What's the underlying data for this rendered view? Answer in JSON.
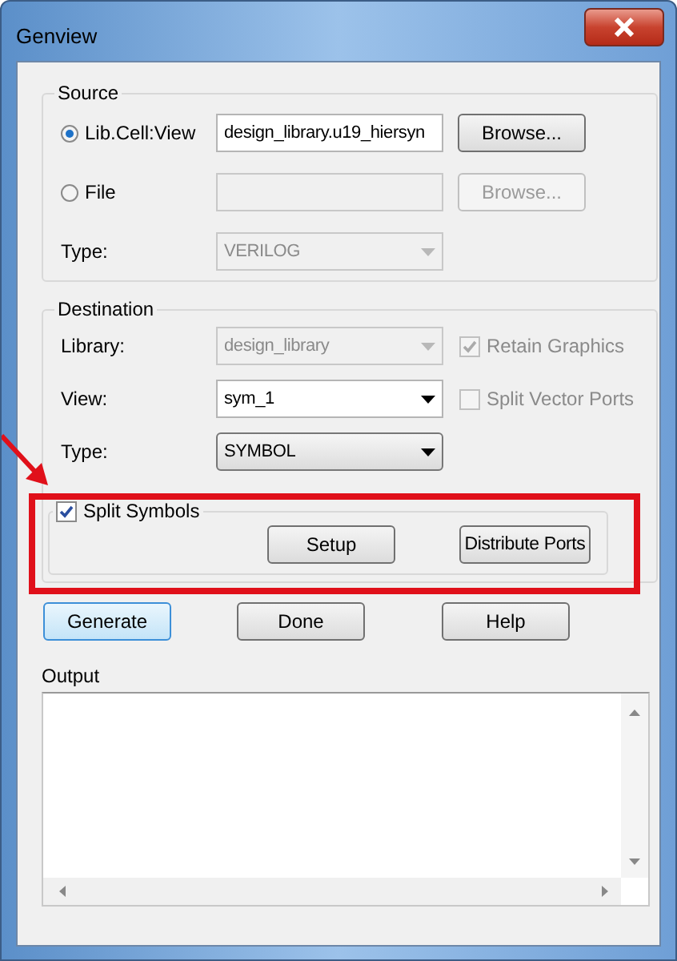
{
  "window": {
    "title": "Genview"
  },
  "source": {
    "title": "Source",
    "options": [
      {
        "label": "Lib.Cell:View",
        "selected": true,
        "value": "design_library.u19_hiersyn",
        "disabled": false,
        "button": {
          "label": "Browse...",
          "disabled": false
        }
      },
      {
        "label": "File",
        "selected": false,
        "disabled": true,
        "button": {
          "label": "Browse...",
          "disabled": true
        }
      }
    ],
    "type": {
      "label": "Type:",
      "value": "VERILOG",
      "disabled": true
    }
  },
  "destination": {
    "title": "Destination",
    "rows": [
      {
        "label": "Library:",
        "value": "design_library",
        "kind": "dropdown",
        "disabled": true,
        "checkbox": {
          "label": "Retain Graphics",
          "checked": true,
          "disabled": true
        }
      },
      {
        "label": "View:",
        "value": "sym_1",
        "kind": "combo",
        "disabled": false,
        "checkbox": {
          "label": "Split Vector Ports",
          "checked": false,
          "disabled": true
        }
      },
      {
        "label": "Type:",
        "value": "SYMBOL",
        "kind": "dropdown",
        "disabled": false
      }
    ],
    "split": {
      "label": "Split Symbols",
      "checked": true,
      "buttons": [
        "Setup",
        "Distribute Ports"
      ]
    }
  },
  "actions": [
    {
      "label": "Generate",
      "default": true
    },
    {
      "label": "Done",
      "default": false
    },
    {
      "label": "Help",
      "default": false
    }
  ],
  "output": {
    "label": "Output"
  }
}
